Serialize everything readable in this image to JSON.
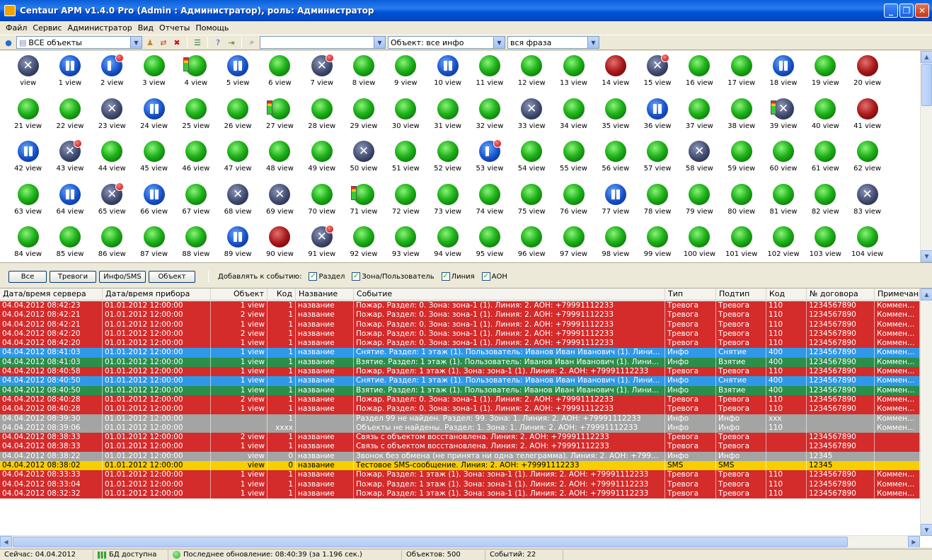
{
  "window": {
    "title": "Centaur АРМ v1.4.0 Pro (Admin : Администратор), роль: Администратор",
    "minimize": "_",
    "maximize": "❐",
    "close": "✕"
  },
  "menu": [
    "Файл",
    "Сервис",
    "Администратор",
    "Вид",
    "Отчеты",
    "Помощь"
  ],
  "toolbar": {
    "group_select": "ВСЕ объекты",
    "search_value": "",
    "object_filter": "Объект: все инфо",
    "match_mode": "вся фраза"
  },
  "objects": [
    {
      "label": "view",
      "state": "tool"
    },
    {
      "label": "1 view",
      "state": "pause"
    },
    {
      "label": "2 view",
      "state": "pause-badge"
    },
    {
      "label": "3 view",
      "state": "green"
    },
    {
      "label": "4 view",
      "state": "green-bat"
    },
    {
      "label": "5 view",
      "state": "pause"
    },
    {
      "label": "6 view",
      "state": "green"
    },
    {
      "label": "7 view",
      "state": "tool-badge"
    },
    {
      "label": "8 view",
      "state": "green"
    },
    {
      "label": "9 view",
      "state": "green"
    },
    {
      "label": "10 view",
      "state": "pause"
    },
    {
      "label": "11 view",
      "state": "green"
    },
    {
      "label": "12 view",
      "state": "green"
    },
    {
      "label": "13 view",
      "state": "green"
    },
    {
      "label": "14 view",
      "state": "red"
    },
    {
      "label": "15 view",
      "state": "tool-badge"
    },
    {
      "label": "16 view",
      "state": "green"
    },
    {
      "label": "17 view",
      "state": "green"
    },
    {
      "label": "18 view",
      "state": "pause"
    },
    {
      "label": "19 view",
      "state": "green"
    },
    {
      "label": "20 view",
      "state": "red"
    },
    {
      "label": "21 view",
      "state": "green"
    },
    {
      "label": "22 view",
      "state": "green"
    },
    {
      "label": "23 view",
      "state": "tool"
    },
    {
      "label": "24 view",
      "state": "pause"
    },
    {
      "label": "25 view",
      "state": "green"
    },
    {
      "label": "26 view",
      "state": "green"
    },
    {
      "label": "27 view",
      "state": "green-bat"
    },
    {
      "label": "28 view",
      "state": "green"
    },
    {
      "label": "29 view",
      "state": "green"
    },
    {
      "label": "30 view",
      "state": "green"
    },
    {
      "label": "31 view",
      "state": "green"
    },
    {
      "label": "32 view",
      "state": "green"
    },
    {
      "label": "33 view",
      "state": "tool"
    },
    {
      "label": "34 view",
      "state": "green"
    },
    {
      "label": "35 view",
      "state": "green"
    },
    {
      "label": "36 view",
      "state": "pause"
    },
    {
      "label": "37 view",
      "state": "green"
    },
    {
      "label": "38 view",
      "state": "green"
    },
    {
      "label": "39 view",
      "state": "tool-bat"
    },
    {
      "label": "40 view",
      "state": "green"
    },
    {
      "label": "41 view",
      "state": "red"
    },
    {
      "label": "42 view",
      "state": "pause"
    },
    {
      "label": "43 view",
      "state": "tool-badge"
    },
    {
      "label": "44 view",
      "state": "green"
    },
    {
      "label": "45 view",
      "state": "green"
    },
    {
      "label": "46 view",
      "state": "green"
    },
    {
      "label": "47 view",
      "state": "green"
    },
    {
      "label": "48 view",
      "state": "green"
    },
    {
      "label": "49 view",
      "state": "green"
    },
    {
      "label": "50 view",
      "state": "tool"
    },
    {
      "label": "51 view",
      "state": "green"
    },
    {
      "label": "52 view",
      "state": "green"
    },
    {
      "label": "53 view",
      "state": "pause-badge"
    },
    {
      "label": "54 view",
      "state": "green"
    },
    {
      "label": "55 view",
      "state": "green"
    },
    {
      "label": "56 view",
      "state": "green"
    },
    {
      "label": "57 view",
      "state": "green"
    },
    {
      "label": "58 view",
      "state": "tool"
    },
    {
      "label": "59 view",
      "state": "green"
    },
    {
      "label": "60 view",
      "state": "green"
    },
    {
      "label": "61 view",
      "state": "green"
    },
    {
      "label": "62 view",
      "state": "green"
    },
    {
      "label": "63 view",
      "state": "green"
    },
    {
      "label": "64 view",
      "state": "pause"
    },
    {
      "label": "65 view",
      "state": "tool-badge"
    },
    {
      "label": "66 view",
      "state": "pause"
    },
    {
      "label": "67 view",
      "state": "green"
    },
    {
      "label": "68 view",
      "state": "tool"
    },
    {
      "label": "69 view",
      "state": "tool"
    },
    {
      "label": "70 view",
      "state": "green"
    },
    {
      "label": "71 view",
      "state": "green-bat"
    },
    {
      "label": "72 view",
      "state": "green"
    },
    {
      "label": "73 view",
      "state": "green"
    },
    {
      "label": "74 view",
      "state": "green"
    },
    {
      "label": "75 view",
      "state": "green"
    },
    {
      "label": "76 view",
      "state": "green"
    },
    {
      "label": "77 view",
      "state": "pause"
    },
    {
      "label": "78 view",
      "state": "green"
    },
    {
      "label": "79 view",
      "state": "green"
    },
    {
      "label": "80 view",
      "state": "green"
    },
    {
      "label": "81 view",
      "state": "green"
    },
    {
      "label": "82 view",
      "state": "green"
    },
    {
      "label": "83 view",
      "state": "tool"
    },
    {
      "label": "84 view",
      "state": "green"
    },
    {
      "label": "85 view",
      "state": "green"
    },
    {
      "label": "86 view",
      "state": "green"
    },
    {
      "label": "87 view",
      "state": "green"
    },
    {
      "label": "88 view",
      "state": "green"
    },
    {
      "label": "89 view",
      "state": "pause"
    },
    {
      "label": "90 view",
      "state": "red"
    },
    {
      "label": "91 view",
      "state": "tool-badge"
    },
    {
      "label": "92 view",
      "state": "green"
    },
    {
      "label": "93 view",
      "state": "green"
    },
    {
      "label": "94 view",
      "state": "green"
    },
    {
      "label": "95 view",
      "state": "green"
    },
    {
      "label": "96 view",
      "state": "green"
    },
    {
      "label": "97 view",
      "state": "green"
    },
    {
      "label": "98 view",
      "state": "green"
    },
    {
      "label": "99 view",
      "state": "green"
    },
    {
      "label": "100 view",
      "state": "green"
    },
    {
      "label": "101 view",
      "state": "green"
    },
    {
      "label": "102 view",
      "state": "green"
    },
    {
      "label": "103 view",
      "state": "green"
    },
    {
      "label": "104 view",
      "state": "green"
    }
  ],
  "filters": {
    "buttons": [
      "Все",
      "Тревоги",
      "Инфо/SMS",
      "Объект"
    ],
    "add_to_event_label": "Добавлять к событию:",
    "checks": [
      "Раздел",
      "Зона/Пользователь",
      "Линия",
      "АОН"
    ],
    "check_mark": "✓"
  },
  "table": {
    "columns": [
      "Дата/время сервера",
      "Дата/время прибора",
      "Объект",
      "Код",
      "Название",
      "Событие",
      "Тип",
      "Подтип",
      "Код",
      "№ договора",
      "Примечание"
    ],
    "rows": [
      {
        "kind": "alarm",
        "cells": [
          "04.04.2012 08:42:23",
          "01.01.2012 12:00:00",
          "1 view",
          "1",
          "название",
          "Пожар. Раздел: 0. Зона: зона-1 (1). Линия: 2. АОН: +79991112233",
          "Тревога",
          "Тревога",
          "110",
          "1234567890",
          "Комментарий"
        ]
      },
      {
        "kind": "alarm",
        "cells": [
          "04.04.2012 08:42:21",
          "01.01.2012 12:00:00",
          "2 view",
          "1",
          "название",
          "Пожар. Раздел: 0. Зона: зона-1 (1). Линия: 2. АОН: +79991112233",
          "Тревога",
          "Тревога",
          "110",
          "1234567890",
          "Комментарий"
        ]
      },
      {
        "kind": "alarm",
        "cells": [
          "04.04.2012 08:42:21",
          "01.01.2012 12:00:00",
          "1 view",
          "1",
          "название",
          "Пожар. Раздел: 0. Зона: зона-1 (1). Линия: 2. АОН: +79991112233",
          "Тревога",
          "Тревога",
          "110",
          "1234567890",
          "Комментарий"
        ]
      },
      {
        "kind": "alarm",
        "cells": [
          "04.04.2012 08:42:20",
          "01.01.2012 12:00:00",
          "2 view",
          "1",
          "название",
          "Пожар. Раздел: 0. Зона: зона-1 (1). Линия: 2. АОН: +79991112233",
          "Тревога",
          "Тревога",
          "110",
          "1234567890",
          "Комментарий"
        ]
      },
      {
        "kind": "alarm",
        "cells": [
          "04.04.2012 08:42:20",
          "01.01.2012 12:00:00",
          "1 view",
          "1",
          "название",
          "Пожар. Раздел: 0. Зона: зона-1 (1). Линия: 2. АОН: +79991112233",
          "Тревога",
          "Тревога",
          "110",
          "1234567890",
          "Комментарий"
        ]
      },
      {
        "kind": "off",
        "cells": [
          "04.04.2012 08:41:03",
          "01.01.2012 12:00:00",
          "1 view",
          "1",
          "название",
          "Снятие. Раздел: 1 этаж (1). Пользователь: Иванов Иван Иванович (1). Лини...",
          "Инфо",
          "Снятие",
          "400",
          "1234567890",
          "Комментарий"
        ]
      },
      {
        "kind": "on",
        "cells": [
          "04.04.2012 08:41:03",
          "01.01.2012 12:00:00",
          "1 view",
          "1",
          "название",
          "Взятие. Раздел: 1 этаж (1). Пользователь: Иванов Иван Иванович (1). Лини...",
          "Инфо",
          "Взятие",
          "400",
          "1234567890",
          "Комментарий"
        ]
      },
      {
        "kind": "alarm",
        "cells": [
          "04.04.2012 08:40:58",
          "01.01.2012 12:00:00",
          "1 view",
          "1",
          "название",
          "Пожар. Раздел: 1 этаж (1). Зона: зона-1 (1). Линия: 2. АОН: +79991112233",
          "Тревога",
          "Тревога",
          "110",
          "1234567890",
          "Комментарий"
        ]
      },
      {
        "kind": "off",
        "cells": [
          "04.04.2012 08:40:50",
          "01.01.2012 12:00:00",
          "1 view",
          "1",
          "название",
          "Снятие. Раздел: 1 этаж (1). Пользователь: Иванов Иван Иванович (1). Лини...",
          "Инфо",
          "Снятие",
          "400",
          "1234567890",
          "Комментарий"
        ]
      },
      {
        "kind": "on",
        "cells": [
          "04.04.2012 08:40:50",
          "01.01.2012 12:00:00",
          "1 view",
          "1",
          "название",
          "Взятие. Раздел: 1 этаж (1). Пользователь: Иванов Иван Иванович (1). Лини...",
          "Инфо",
          "Взятие",
          "400",
          "1234567890",
          "Комментарий"
        ]
      },
      {
        "kind": "alarm",
        "cells": [
          "04.04.2012 08:40:28",
          "01.01.2012 12:00:00",
          "2 view",
          "1",
          "название",
          "Пожар. Раздел: 0. Зона: зона-1 (1). Линия: 2. АОН: +79991112233",
          "Тревога",
          "Тревога",
          "110",
          "1234567890",
          "Комментарий"
        ]
      },
      {
        "kind": "alarm",
        "cells": [
          "04.04.2012 08:40:28",
          "01.01.2012 12:00:00",
          "1 view",
          "1",
          "название",
          "Пожар. Раздел: 0. Зона: зона-1 (1). Линия: 2. АОН: +79991112233",
          "Тревога",
          "Тревога",
          "110",
          "1234567890",
          "Комментарий"
        ]
      },
      {
        "kind": "info",
        "cells": [
          "04.04.2012 08:39:30",
          "01.01.2012 12:00:00",
          "",
          "1",
          "",
          "Раздел 99 не найден. Раздел: 99. Зона: 1. Линия: 2. АОН: +79991112233",
          "Инфо",
          "Инфо",
          "xxx",
          "",
          "Комментарий"
        ]
      },
      {
        "kind": "info",
        "cells": [
          "04.04.2012 08:39:06",
          "01.01.2012 12:00:00",
          "",
          "xxxx",
          "",
          "Объекты не найдены. Раздел: 1. Зона: 1. Линия: 2. АОН: +79991112233",
          "Инфо",
          "Инфо",
          "110",
          "",
          "Комментарий"
        ]
      },
      {
        "kind": "alarm",
        "cells": [
          "04.04.2012 08:38:33",
          "01.01.2012 12:00:00",
          "2 view",
          "1",
          "название",
          "Связь с объектом восстановлена. Линия: 2. АОН: +79991112233",
          "Тревога",
          "Тревога",
          "",
          "1234567890",
          ""
        ]
      },
      {
        "kind": "alarm",
        "cells": [
          "04.04.2012 08:38:33",
          "01.01.2012 12:00:00",
          "1 view",
          "1",
          "название",
          "Связь с объектом восстановлена. Линия: 2. АОН: +79991112233",
          "Тревога",
          "Тревога",
          "",
          "1234567890",
          ""
        ]
      },
      {
        "kind": "info",
        "cells": [
          "04.04.2012 08:38:22",
          "01.01.2012 12:00:00",
          "view",
          "0",
          "название",
          "Звонок без обмена (не принята ни одна телеграмма). Линия: 2. АОН: +7999...",
          "Инфо",
          "Инфо",
          "",
          "12345",
          ""
        ]
      },
      {
        "kind": "sms",
        "cells": [
          "04.04.2012 08:38:02",
          "01.01.2012 12:00:00",
          "view",
          "0",
          "название",
          "Тестовое SMS-сообщение. Линия: 2. АОН: +79991112233",
          "SMS",
          "SMS",
          "",
          "12345",
          ""
        ]
      },
      {
        "kind": "alarm",
        "cells": [
          "04.04.2012 08:33:33",
          "01.01.2012 12:00:00",
          "1 view",
          "1",
          "название",
          "Пожар. Раздел: 1 этаж (1). Зона: зона-1 (1). Линия: 2. АОН: +79991112233",
          "Тревога",
          "Тревога",
          "110",
          "1234567890",
          "Комментарий"
        ]
      },
      {
        "kind": "alarm",
        "cells": [
          "04.04.2012 08:33:04",
          "01.01.2012 12:00:00",
          "1 view",
          "1",
          "название",
          "Пожар. Раздел: 1 этаж (1). Зона: зона-1 (1). Линия: 2. АОН: +79991112233",
          "Тревога",
          "Тревога",
          "110",
          "1234567890",
          "Комментарий"
        ]
      },
      {
        "kind": "alarm",
        "cells": [
          "04.04.2012 08:32:32",
          "01.01.2012 12:00:00",
          "1 view",
          "1",
          "название",
          "Пожар. Раздел: 1 этаж (1). Зона: зона-1 (1). Линия: 2. АОН: +79991112233",
          "Тревога",
          "Тревога",
          "110",
          "1234567890",
          "Комментарий"
        ]
      }
    ]
  },
  "status": {
    "now": "Сейчас: 04.04.2012",
    "db": "БД доступна",
    "last_update": "Последнее обновление: 08:40:39  (за 1.196 сек.)",
    "objects_count": "Объектов: 500",
    "events_count": "Событий: 22"
  },
  "colors": {
    "alarm": "#d42b2b",
    "disarm": "#2f98e9",
    "arm": "#2a8f4a",
    "info": "#a4a4a4",
    "sms": "#f7cf00"
  }
}
